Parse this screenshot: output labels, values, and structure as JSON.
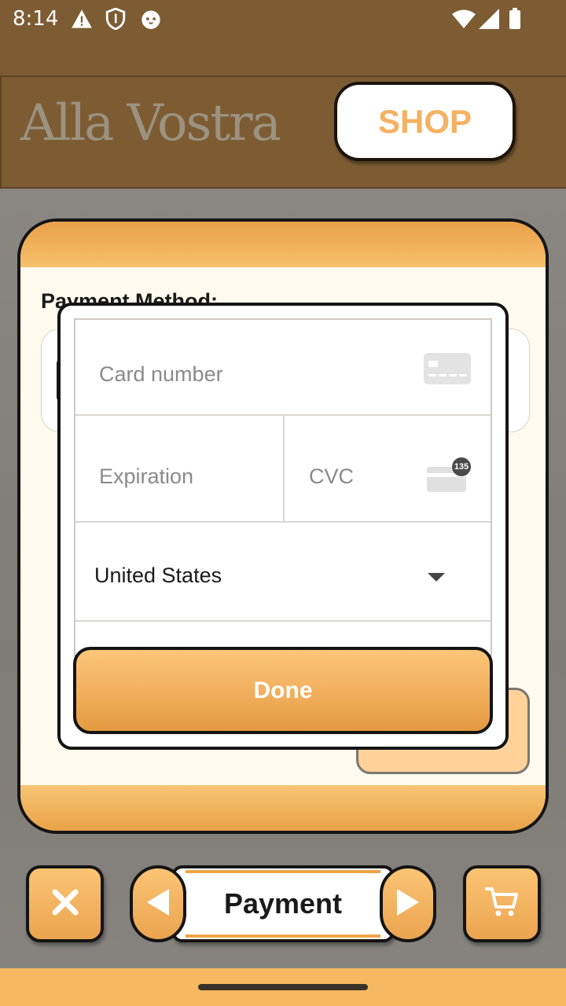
{
  "status_bar": {
    "time": "8:14",
    "icons": [
      "warning-icon",
      "shield-icon",
      "cat-icon",
      "wifi-icon",
      "signal-icon",
      "battery-icon"
    ]
  },
  "header": {
    "brand": "Alla Vostra",
    "shop_label": "SHOP"
  },
  "payment_panel": {
    "method_label": "Payment Method:"
  },
  "card_form": {
    "card_number_placeholder": "Card number",
    "expiration_placeholder": "Expiration",
    "cvc_placeholder": "CVC",
    "cvc_badge": "135",
    "country": "United States",
    "done_label": "Done"
  },
  "bottom_nav": {
    "close_icon": "close-icon",
    "prev_icon": "arrow-left-icon",
    "step_label": "Payment",
    "next_icon": "arrow-right-icon",
    "cart_icon": "cart-icon"
  },
  "colors": {
    "header_bg": "#7d5c34",
    "accent_orange": "#f0a447",
    "shop_text": "#f3b263"
  }
}
